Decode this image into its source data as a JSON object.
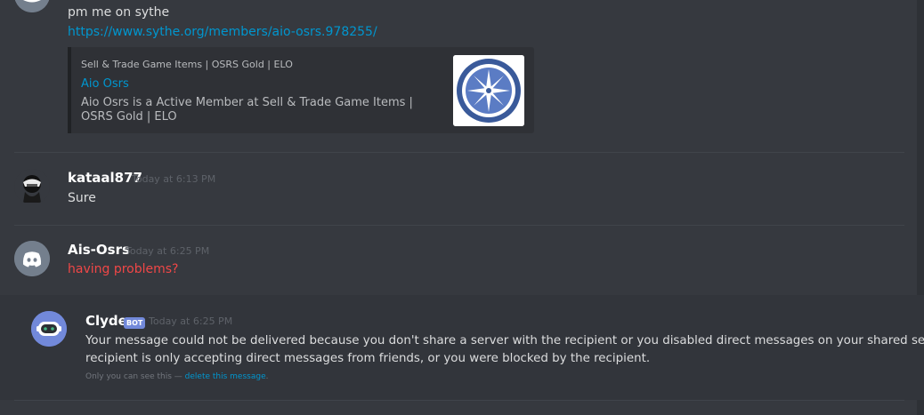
{
  "messages": {
    "first": {
      "line1": "pm me on sythe",
      "link": "https://www.sythe.org/members/aio-osrs.978255/",
      "embed": {
        "provider": "Sell & Trade Game Items | OSRS Gold | ELO",
        "title": "Aio Osrs",
        "description": "Aio Osrs is a Active Member at Sell & Trade Game Items | OSRS Gold | ELO",
        "thumbnail_icon": "compass-star-logo-icon"
      }
    },
    "kataal": {
      "username": "kataal877",
      "timestamp": "Today at 6:13 PM",
      "text": "Sure"
    },
    "ais": {
      "username": "Ais-Osrs",
      "timestamp": "Today at 6:25 PM",
      "text": "having problems?",
      "text_color": "#f04747"
    },
    "clyde": {
      "username": "Clyde",
      "bot_tag": "BOT",
      "timestamp": "Today at 6:25 PM",
      "line1": "Your message could not be delivered because you don't share a server with the recipient or you disabled direct messages on your shared server,",
      "line2": "recipient is only accepting direct messages from friends, or you were blocked by the recipient.",
      "ephemeral_prefix": "Only you can see this — ",
      "ephemeral_link": "delete this message",
      "ephemeral_suffix": "."
    }
  },
  "colors": {
    "background": "#36393f",
    "link": "#0096cf",
    "bot_tag": "#7289da",
    "discord_blurple": "#7289da",
    "discord_gray": "#747f8d"
  }
}
